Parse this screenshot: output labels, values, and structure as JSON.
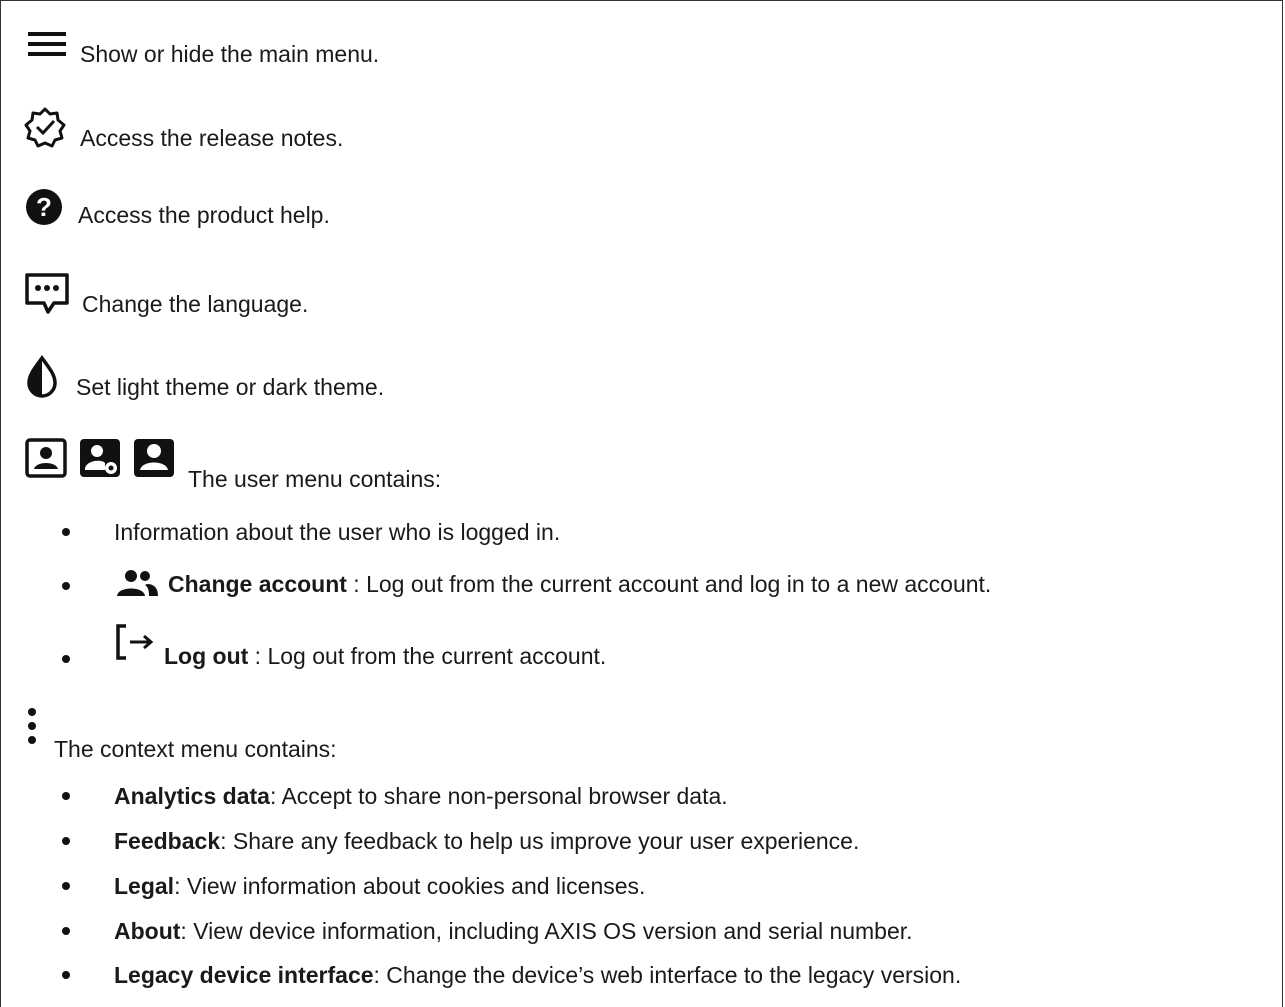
{
  "items": {
    "menu": "Show or hide the main menu.",
    "release_notes": "Access the release notes.",
    "help": "Access the product help.",
    "language": "Change the language.",
    "theme": "Set light theme or dark theme.",
    "user_menu": "The user menu contains:",
    "context_menu": "The context menu contains:"
  },
  "user_menu_list": {
    "info": "Information about the user who is logged in.",
    "change_account_term": "Change account",
    "change_account_desc": " : Log out from the current account and log in to a new account.",
    "log_out_term": "Log out",
    "log_out_desc": " : Log out from the current account."
  },
  "context_menu_list": [
    {
      "term": "Analytics data",
      "desc": ": Accept to share non-personal browser data."
    },
    {
      "term": "Feedback",
      "desc": ": Share any feedback to help us improve your user experience."
    },
    {
      "term": "Legal",
      "desc": ": View information about cookies and licenses."
    },
    {
      "term": "About",
      "desc": ": View device information, including AXIS OS version and serial number."
    },
    {
      "term": "Legacy device interface",
      "desc": ": Change the device’s web interface to the legacy version."
    }
  ],
  "icons": [
    "menu-icon",
    "release-notes-icon",
    "help-icon",
    "language-icon",
    "theme-icon",
    "user-icon",
    "user-settings-icon",
    "user-filled-icon",
    "change-account-icon",
    "log-out-icon",
    "more-vert-icon"
  ]
}
